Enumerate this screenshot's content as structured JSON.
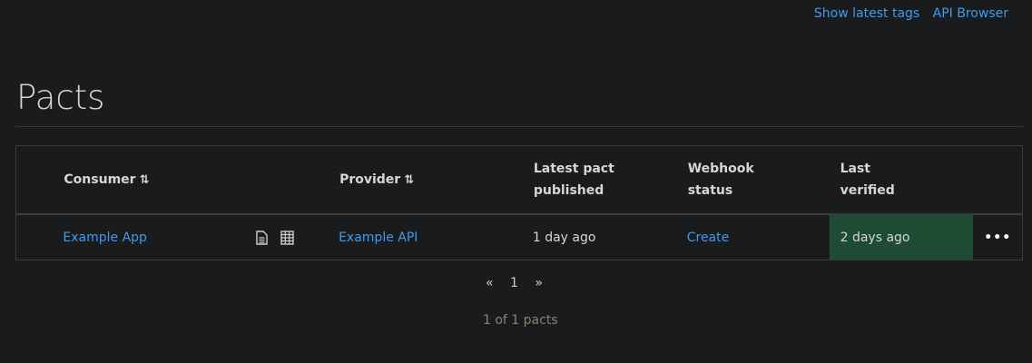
{
  "top_links": [
    "Show latest tags",
    "API Browser"
  ],
  "title": "Pacts",
  "table": {
    "headers": {
      "consumer": "Consumer",
      "provider": "Provider",
      "latest": "Latest pact published",
      "webhook": "Webhook status",
      "verified": "Last verified"
    },
    "sort_icon": "⇅",
    "rows": [
      {
        "consumer": "Example App",
        "provider": "Example API",
        "latest": "1 day ago",
        "webhook": "Create",
        "verified": "2 days ago",
        "more": "•••"
      }
    ]
  },
  "pagination": {
    "prev": "«",
    "page": "1",
    "next": "»"
  },
  "count": "1 of 1 pacts",
  "colors": {
    "background": "#1a1b1d",
    "link": "#3d9bf0",
    "verified_success": "#1f4a33"
  }
}
